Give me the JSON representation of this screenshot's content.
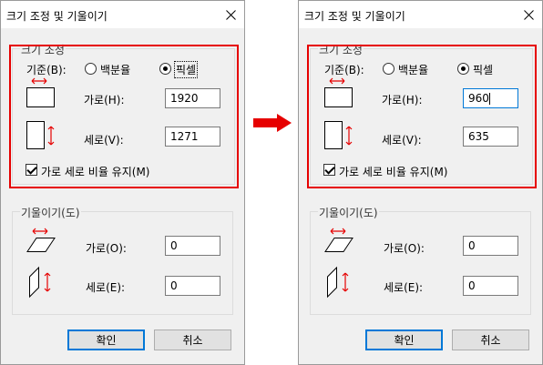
{
  "dialogs": [
    {
      "title": "크기 조정 및 기울이기",
      "resize": {
        "group_label": "크기 조정",
        "basis_label": "기준(B):",
        "option_percent": "백분율",
        "option_pixel": "픽셀",
        "selected": "픽셀",
        "horizontal_label": "가로(H):",
        "horizontal_value": "1920",
        "vertical_label": "세로(V):",
        "vertical_value": "1271",
        "keep_ratio_label": "가로 세로 비율 유지(M)",
        "keep_ratio_checked": true
      },
      "skew": {
        "group_label": "기울이기(도)",
        "horizontal_label": "가로(O):",
        "horizontal_value": "0",
        "vertical_label": "세로(E):",
        "vertical_value": "0"
      },
      "ok_label": "확인",
      "cancel_label": "취소"
    },
    {
      "title": "크기 조정 및 기울이기",
      "resize": {
        "group_label": "크기 조정",
        "basis_label": "기준(B):",
        "option_percent": "백분율",
        "option_pixel": "픽셀",
        "selected": "픽셀",
        "horizontal_label": "가로(H):",
        "horizontal_value": "960",
        "vertical_label": "세로(V):",
        "vertical_value": "635",
        "keep_ratio_label": "가로 세로 비율 유지(M)",
        "keep_ratio_checked": true
      },
      "skew": {
        "group_label": "기울이기(도)",
        "horizontal_label": "가로(O):",
        "horizontal_value": "0",
        "vertical_label": "세로(E):",
        "vertical_value": "0"
      },
      "ok_label": "확인",
      "cancel_label": "취소"
    }
  ],
  "colors": {
    "highlight_border": "#e60000",
    "transition_arrow": "#e60000",
    "accent_focus": "#0078d7",
    "dialog_background": "#f0f0f0"
  },
  "icons": {
    "transition": "right-arrow-icon",
    "close": "close-icon",
    "resize_horizontal": "resize-horizontal-icon",
    "resize_vertical": "resize-vertical-icon",
    "skew_horizontal": "skew-horizontal-icon",
    "skew_vertical": "skew-vertical-icon"
  }
}
